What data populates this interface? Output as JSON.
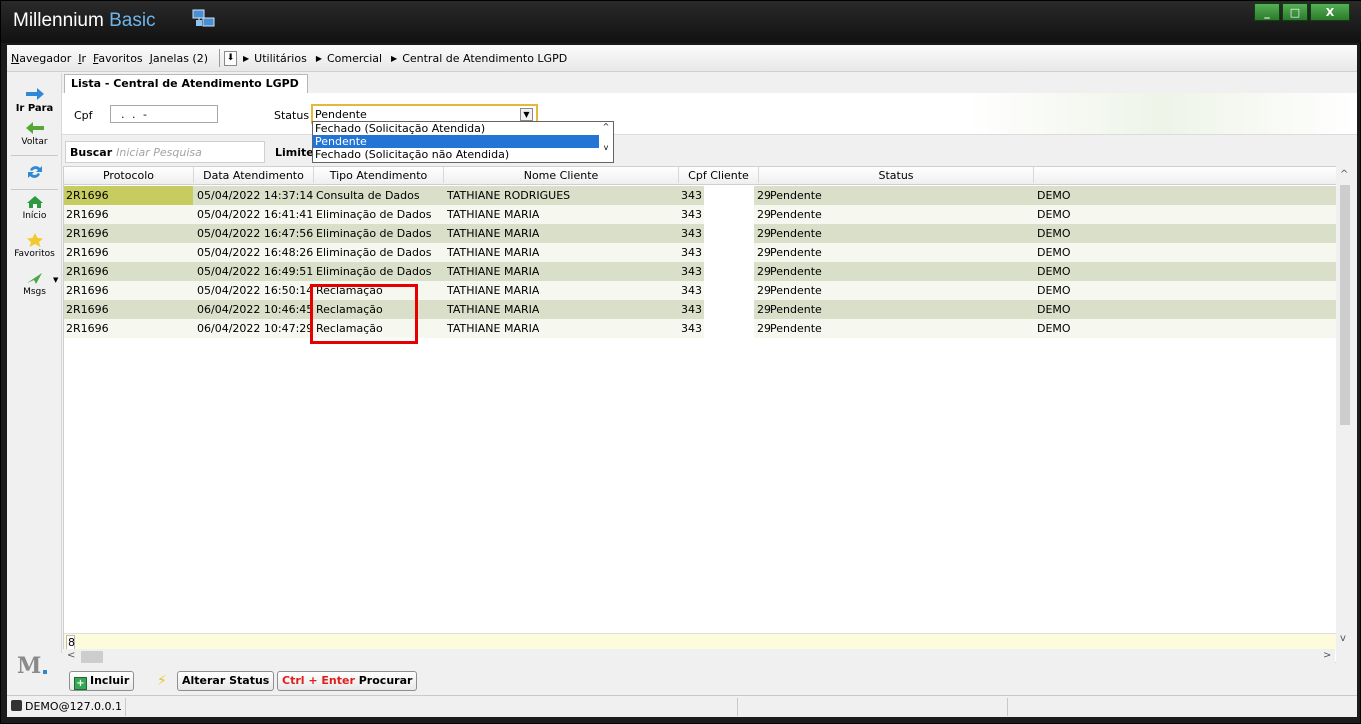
{
  "window": {
    "title_main": "Millennium",
    "title_accent": "Basic",
    "controls": [
      "_",
      "□",
      "X"
    ]
  },
  "menu": {
    "items": [
      {
        "pre": "",
        "u": "N",
        "post": "avegador"
      },
      {
        "pre": "",
        "u": "I",
        "post": "r"
      },
      {
        "pre": "",
        "u": "F",
        "post": "avoritos"
      },
      {
        "pre": "",
        "u": "J",
        "post": "anelas (2)"
      }
    ],
    "down_button": "⬇",
    "breadcrumb": [
      "Utilitários",
      "Comercial",
      "Central de Atendimento LGPD"
    ]
  },
  "sidebar": {
    "items": [
      {
        "label": "Ir Para",
        "icon": "arrow-right-icon"
      },
      {
        "label": "Voltar",
        "icon": "arrow-left-icon"
      },
      {
        "label": "",
        "icon": "refresh-icon"
      },
      {
        "label": "Início",
        "icon": "home-icon"
      },
      {
        "label": "Favoritos",
        "icon": "star-icon"
      },
      {
        "label": "Msgs",
        "icon": "message-icon"
      }
    ],
    "logo": "M"
  },
  "tab": {
    "label": "Lista - Central de Atendimento LGPD"
  },
  "filters": {
    "cpf_label": "Cpf",
    "cpf_value": ". . -",
    "status_label": "Status",
    "status_value": "Pendente",
    "status_options": [
      "Fechado (Solicitação Atendida)",
      "Pendente",
      "Fechado (Solicitação não Atendida)"
    ],
    "selected_index": 1
  },
  "search": {
    "label": "Buscar",
    "placeholder": "Iniciar Pesquisa",
    "limit_label": "Limite"
  },
  "grid": {
    "columns": [
      "Protocolo",
      "Data Atendimento",
      "Tipo Atendimento",
      "Nome Cliente",
      "Cpf Cliente",
      "Status",
      ""
    ],
    "rows": [
      [
        "2R1696",
        "05/04/2022 14:37:14",
        "Consulta de Dados",
        "TATHIANE RODRIGUES",
        "343",
        "29",
        "Pendente",
        "DEMO"
      ],
      [
        "2R1696",
        "05/04/2022 16:41:41",
        "Eliminação de Dados",
        "TATHIANE MARIA",
        "343",
        "29",
        "Pendente",
        "DEMO"
      ],
      [
        "2R1696",
        "05/04/2022 16:47:56",
        "Eliminação de Dados",
        "TATHIANE MARIA",
        "343",
        "29",
        "Pendente",
        "DEMO"
      ],
      [
        "2R1696",
        "05/04/2022 16:48:26",
        "Eliminação de Dados",
        "TATHIANE MARIA",
        "343",
        "29",
        "Pendente",
        "DEMO"
      ],
      [
        "2R1696",
        "05/04/2022 16:49:51",
        "Eliminação de Dados",
        "TATHIANE MARIA",
        "343",
        "29",
        "Pendente",
        "DEMO"
      ],
      [
        "2R1696",
        "05/04/2022 16:50:14",
        "Reclamação",
        "TATHIANE MARIA",
        "343",
        "29",
        "Pendente",
        "DEMO"
      ],
      [
        "2R1696",
        "06/04/2022 10:46:45",
        "Reclamação",
        "TATHIANE MARIA",
        "343",
        "29",
        "Pendente",
        "DEMO"
      ],
      [
        "2R1696",
        "06/04/2022 10:47:29",
        "Reclamação",
        "TATHIANE MARIA",
        "343",
        "29",
        "Pendente",
        "DEMO"
      ]
    ],
    "count": "8"
  },
  "toolbar": {
    "incluir": "Incluir",
    "alterar_status": "Alterar Status",
    "ctrl_enter": "Ctrl + Enter",
    "procurar": "Procurar"
  },
  "status_bar": {
    "user": "DEMO@127.0.0.1"
  },
  "colors": {
    "row_even": "#d9dfc9",
    "row_odd": "#f6f7ef",
    "selected": "#2374d4",
    "highlight": "#e60000"
  }
}
